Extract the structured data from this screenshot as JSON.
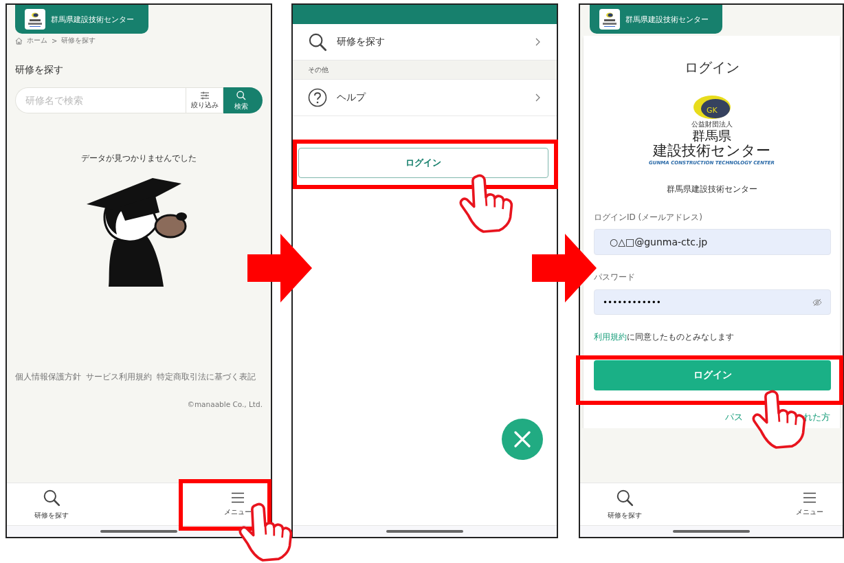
{
  "search_screen": {
    "header_title": "群馬県建設技術センター",
    "breadcrumb": [
      "ホーム",
      "研修を探す"
    ],
    "breadcrumb_separator": ">",
    "page_title": "研修を探す",
    "search": {
      "placeholder": "研修名で検索",
      "filter_label": "絞り込み",
      "search_label": "検索"
    },
    "empty_message": "データが見つかりませんでした",
    "footer_links": [
      "個人情報保護方針",
      "サービス利用規約",
      "特定商取引法に基づく表記"
    ],
    "copyright": "©manaable Co., Ltd.",
    "bottom_nav": [
      {
        "label": "研修を探す"
      },
      {
        "label": "メニュー"
      }
    ]
  },
  "menu_screen": {
    "menu": [
      {
        "kind": "link",
        "label": "研修を探す"
      },
      {
        "kind": "section",
        "label": "その他"
      },
      {
        "kind": "link",
        "label": "ヘルプ"
      }
    ],
    "login_button": "ログイン"
  },
  "login_screen": {
    "header_title": "群馬県建設技術センター",
    "title": "ログイン",
    "logo": {
      "badge": "GK",
      "corporation": "公益財団法人",
      "line_1": "群馬県",
      "line_2": "建設技術センター",
      "english": "GUNMA CONSTRUCTION TECHNOLOGY CENTER"
    },
    "organization": "群馬県建設技術センター",
    "id_label": "ログインID (メールアドレス)",
    "id_value": "○△□@gunma-ctc.jp",
    "password_label": "パスワード",
    "password_value": "••••••••••••",
    "terms_link": "利用規約",
    "terms_text": "に同意したものとみなします",
    "login_button": "ログイン",
    "forgot_password_visible": [
      "パス",
      "れた方"
    ],
    "bottom_nav": [
      {
        "label": "研修を探す"
      },
      {
        "label": "メニュー"
      }
    ]
  }
}
